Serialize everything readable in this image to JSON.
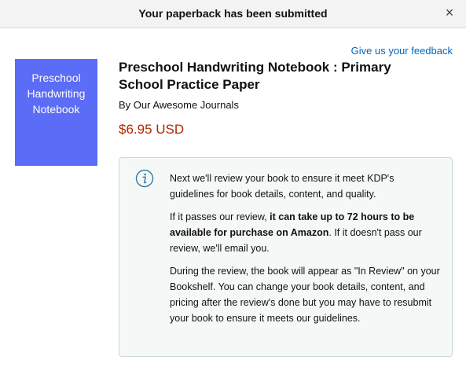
{
  "header": {
    "title": "Your paperback has been submitted",
    "close_glyph": "×"
  },
  "feedback_link": "Give us your feedback",
  "book": {
    "cover_text": "Preschool Handwriting Notebook",
    "cover_color": "#5b6cf6",
    "title": "Preschool Handwriting Notebook : Primary School Practice Paper",
    "author": "By Our Awesome Journals",
    "price": "$6.95 USD",
    "price_color": "#b12704"
  },
  "info": {
    "icon": "info-icon",
    "p1": "Next we'll review your book to ensure it meet KDP's guidelines for book details, content, and quality.",
    "p2_pre": "If it passes our review, ",
    "p2_bold": "it can take up to 72 hours to be available for purchase on Amazon",
    "p2_post": ". If it doesn't pass our review, we'll email you.",
    "p3": "During the review, the book will appear as \"In Review\" on your Bookshelf. You can change your book details, content, and pricing after the review's done but you may have to resubmit your book to ensure it meets our guidelines."
  },
  "colors": {
    "link": "#0066c0",
    "header_bg": "#f3f3f3",
    "info_bg": "#f6f8f8",
    "info_border": "#c8d6da"
  }
}
